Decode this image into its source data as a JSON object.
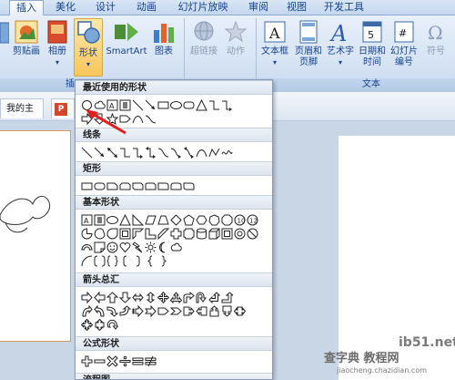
{
  "tabs": [
    "插入",
    "美化",
    "设计",
    "动画",
    "幻灯片放映",
    "审阅",
    "视图",
    "开发工具"
  ],
  "ribbon": {
    "buttons": {
      "clipart": "剪贴画",
      "album": "相册",
      "shapes": "形状",
      "smartart": "SmartArt",
      "chart": "图表",
      "hyperlink": "超链接",
      "action": "动作",
      "textbox": "文本框",
      "header_footer_1": "页眉和",
      "header_footer_2": "页脚",
      "wordart": "艺术字",
      "datetime_1": "日期和",
      "datetime_2": "时间",
      "slidenum_1": "幻灯片",
      "slidenum_2": "编号",
      "symbol": "符号"
    },
    "groups": {
      "illustrations_cut": "插",
      "text": "文本"
    }
  },
  "doc_tabs": [
    "我的主页",
    "P"
  ],
  "gallery": {
    "sections": [
      "最近使用的形状",
      "线条",
      "矩形",
      "基本形状",
      "箭头总汇",
      "公式形状",
      "流程图"
    ]
  },
  "watermark": {
    "line1": "ib51.net",
    "line2": "查字典 教程网",
    "line3": "jiaocheng.chazidian.com"
  },
  "colors": {
    "ribbon_bg": "#d7e4f4",
    "pressed": "#f8c65e",
    "arrow": "#e02020",
    "thumb_border": "#d29b61"
  }
}
